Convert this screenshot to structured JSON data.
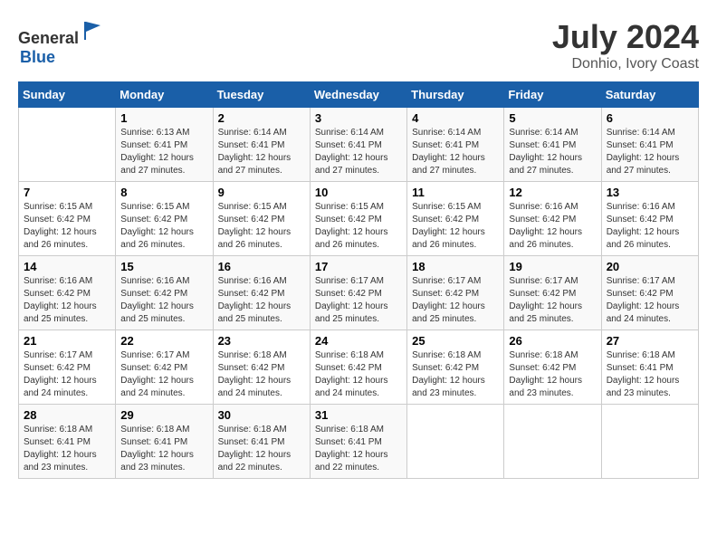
{
  "logo": {
    "general": "General",
    "blue": "Blue"
  },
  "header": {
    "month_year": "July 2024",
    "location": "Donhio, Ivory Coast"
  },
  "days_of_week": [
    "Sunday",
    "Monday",
    "Tuesday",
    "Wednesday",
    "Thursday",
    "Friday",
    "Saturday"
  ],
  "weeks": [
    [
      {
        "day": "",
        "sunrise": "",
        "sunset": "",
        "daylight": ""
      },
      {
        "day": "1",
        "sunrise": "Sunrise: 6:13 AM",
        "sunset": "Sunset: 6:41 PM",
        "daylight": "Daylight: 12 hours and 27 minutes."
      },
      {
        "day": "2",
        "sunrise": "Sunrise: 6:14 AM",
        "sunset": "Sunset: 6:41 PM",
        "daylight": "Daylight: 12 hours and 27 minutes."
      },
      {
        "day": "3",
        "sunrise": "Sunrise: 6:14 AM",
        "sunset": "Sunset: 6:41 PM",
        "daylight": "Daylight: 12 hours and 27 minutes."
      },
      {
        "day": "4",
        "sunrise": "Sunrise: 6:14 AM",
        "sunset": "Sunset: 6:41 PM",
        "daylight": "Daylight: 12 hours and 27 minutes."
      },
      {
        "day": "5",
        "sunrise": "Sunrise: 6:14 AM",
        "sunset": "Sunset: 6:41 PM",
        "daylight": "Daylight: 12 hours and 27 minutes."
      },
      {
        "day": "6",
        "sunrise": "Sunrise: 6:14 AM",
        "sunset": "Sunset: 6:41 PM",
        "daylight": "Daylight: 12 hours and 27 minutes."
      }
    ],
    [
      {
        "day": "7",
        "sunrise": "Sunrise: 6:15 AM",
        "sunset": "Sunset: 6:42 PM",
        "daylight": "Daylight: 12 hours and 26 minutes."
      },
      {
        "day": "8",
        "sunrise": "Sunrise: 6:15 AM",
        "sunset": "Sunset: 6:42 PM",
        "daylight": "Daylight: 12 hours and 26 minutes."
      },
      {
        "day": "9",
        "sunrise": "Sunrise: 6:15 AM",
        "sunset": "Sunset: 6:42 PM",
        "daylight": "Daylight: 12 hours and 26 minutes."
      },
      {
        "day": "10",
        "sunrise": "Sunrise: 6:15 AM",
        "sunset": "Sunset: 6:42 PM",
        "daylight": "Daylight: 12 hours and 26 minutes."
      },
      {
        "day": "11",
        "sunrise": "Sunrise: 6:15 AM",
        "sunset": "Sunset: 6:42 PM",
        "daylight": "Daylight: 12 hours and 26 minutes."
      },
      {
        "day": "12",
        "sunrise": "Sunrise: 6:16 AM",
        "sunset": "Sunset: 6:42 PM",
        "daylight": "Daylight: 12 hours and 26 minutes."
      },
      {
        "day": "13",
        "sunrise": "Sunrise: 6:16 AM",
        "sunset": "Sunset: 6:42 PM",
        "daylight": "Daylight: 12 hours and 26 minutes."
      }
    ],
    [
      {
        "day": "14",
        "sunrise": "Sunrise: 6:16 AM",
        "sunset": "Sunset: 6:42 PM",
        "daylight": "Daylight: 12 hours and 25 minutes."
      },
      {
        "day": "15",
        "sunrise": "Sunrise: 6:16 AM",
        "sunset": "Sunset: 6:42 PM",
        "daylight": "Daylight: 12 hours and 25 minutes."
      },
      {
        "day": "16",
        "sunrise": "Sunrise: 6:16 AM",
        "sunset": "Sunset: 6:42 PM",
        "daylight": "Daylight: 12 hours and 25 minutes."
      },
      {
        "day": "17",
        "sunrise": "Sunrise: 6:17 AM",
        "sunset": "Sunset: 6:42 PM",
        "daylight": "Daylight: 12 hours and 25 minutes."
      },
      {
        "day": "18",
        "sunrise": "Sunrise: 6:17 AM",
        "sunset": "Sunset: 6:42 PM",
        "daylight": "Daylight: 12 hours and 25 minutes."
      },
      {
        "day": "19",
        "sunrise": "Sunrise: 6:17 AM",
        "sunset": "Sunset: 6:42 PM",
        "daylight": "Daylight: 12 hours and 25 minutes."
      },
      {
        "day": "20",
        "sunrise": "Sunrise: 6:17 AM",
        "sunset": "Sunset: 6:42 PM",
        "daylight": "Daylight: 12 hours and 24 minutes."
      }
    ],
    [
      {
        "day": "21",
        "sunrise": "Sunrise: 6:17 AM",
        "sunset": "Sunset: 6:42 PM",
        "daylight": "Daylight: 12 hours and 24 minutes."
      },
      {
        "day": "22",
        "sunrise": "Sunrise: 6:17 AM",
        "sunset": "Sunset: 6:42 PM",
        "daylight": "Daylight: 12 hours and 24 minutes."
      },
      {
        "day": "23",
        "sunrise": "Sunrise: 6:18 AM",
        "sunset": "Sunset: 6:42 PM",
        "daylight": "Daylight: 12 hours and 24 minutes."
      },
      {
        "day": "24",
        "sunrise": "Sunrise: 6:18 AM",
        "sunset": "Sunset: 6:42 PM",
        "daylight": "Daylight: 12 hours and 24 minutes."
      },
      {
        "day": "25",
        "sunrise": "Sunrise: 6:18 AM",
        "sunset": "Sunset: 6:42 PM",
        "daylight": "Daylight: 12 hours and 23 minutes."
      },
      {
        "day": "26",
        "sunrise": "Sunrise: 6:18 AM",
        "sunset": "Sunset: 6:42 PM",
        "daylight": "Daylight: 12 hours and 23 minutes."
      },
      {
        "day": "27",
        "sunrise": "Sunrise: 6:18 AM",
        "sunset": "Sunset: 6:41 PM",
        "daylight": "Daylight: 12 hours and 23 minutes."
      }
    ],
    [
      {
        "day": "28",
        "sunrise": "Sunrise: 6:18 AM",
        "sunset": "Sunset: 6:41 PM",
        "daylight": "Daylight: 12 hours and 23 minutes."
      },
      {
        "day": "29",
        "sunrise": "Sunrise: 6:18 AM",
        "sunset": "Sunset: 6:41 PM",
        "daylight": "Daylight: 12 hours and 23 minutes."
      },
      {
        "day": "30",
        "sunrise": "Sunrise: 6:18 AM",
        "sunset": "Sunset: 6:41 PM",
        "daylight": "Daylight: 12 hours and 22 minutes."
      },
      {
        "day": "31",
        "sunrise": "Sunrise: 6:18 AM",
        "sunset": "Sunset: 6:41 PM",
        "daylight": "Daylight: 12 hours and 22 minutes."
      },
      {
        "day": "",
        "sunrise": "",
        "sunset": "",
        "daylight": ""
      },
      {
        "day": "",
        "sunrise": "",
        "sunset": "",
        "daylight": ""
      },
      {
        "day": "",
        "sunrise": "",
        "sunset": "",
        "daylight": ""
      }
    ]
  ]
}
